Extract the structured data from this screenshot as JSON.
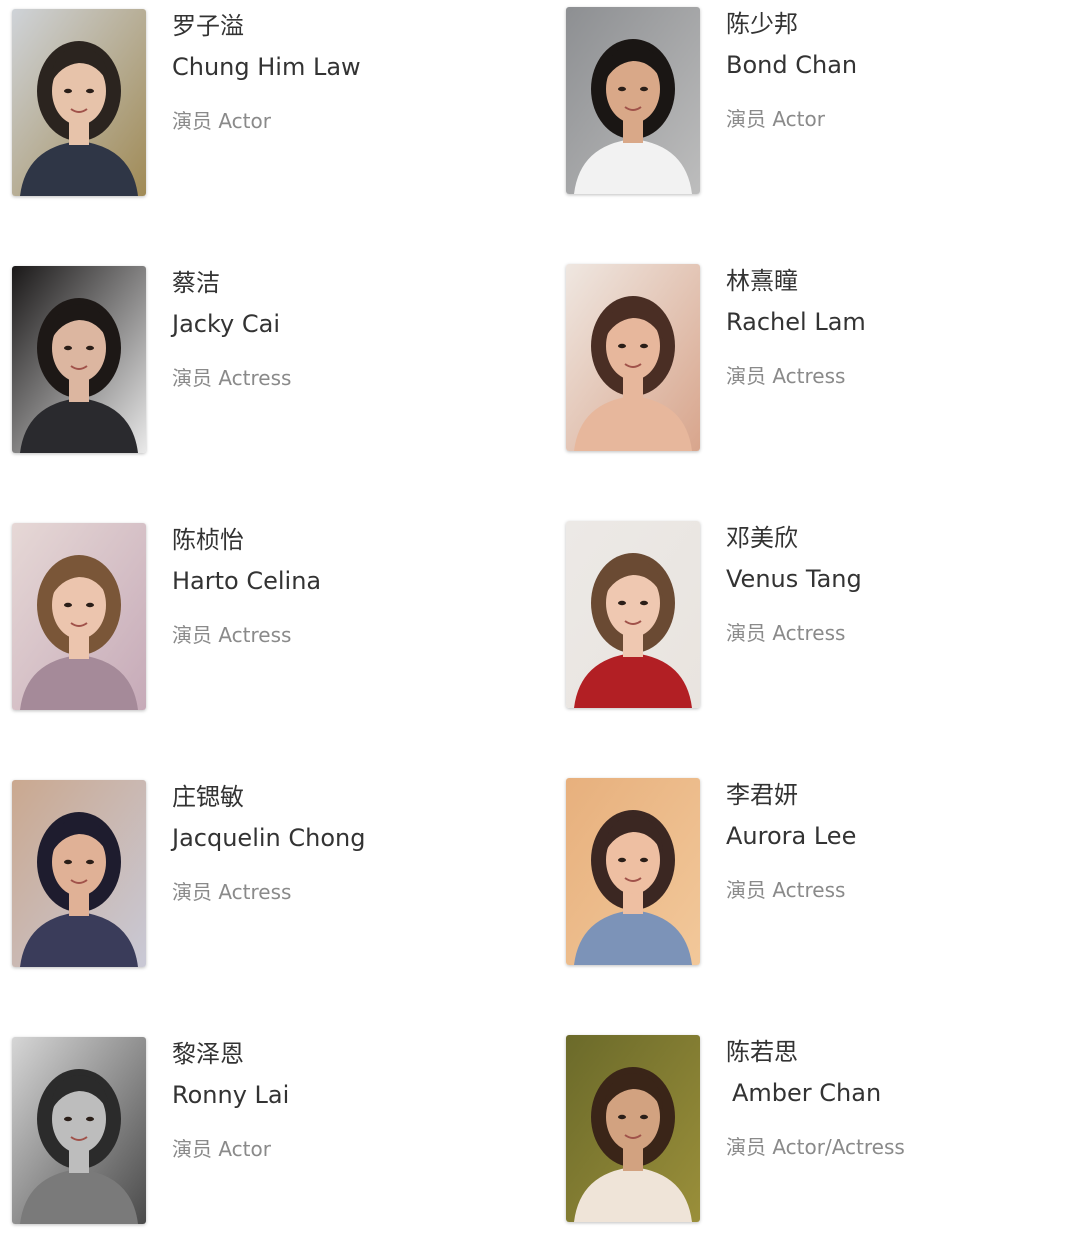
{
  "cast": [
    {
      "cn": "罗子溢",
      "en": "Chung Him Law",
      "role": "演员 Actor",
      "palette": {
        "bg": "#cfd3d8",
        "skin": "#e7c3aa",
        "hair": "#2b241f",
        "cloth": "#2f3646",
        "accent": "#a08a55"
      }
    },
    {
      "cn": "陈少邦",
      "en": "Bond Chan",
      "role": "演员 Actor",
      "palette": {
        "bg": "#8d8f92",
        "skin": "#d9a888",
        "hair": "#1a1614",
        "cloth": "#f2f2f2",
        "accent": "#bdbdbd"
      }
    },
    {
      "cn": "蔡洁",
      "en": "Jacky Cai",
      "role": "演员 Actress",
      "palette": {
        "bg": "#1a1818",
        "skin": "#dcb6a0",
        "hair": "#1d1816",
        "cloth": "#2a2a2e",
        "accent": "#e9e9e9"
      }
    },
    {
      "cn": "林熹瞳",
      "en": "Rachel Lam",
      "role": "演员 Actress",
      "palette": {
        "bg": "#efe7e1",
        "skin": "#e7b79c",
        "hair": "#4a2e24",
        "cloth": "#e7b79c",
        "accent": "#d8a58c"
      }
    },
    {
      "cn": "陈桢怡",
      "en": "Harto Celina",
      "role": "演员 Actress",
      "palette": {
        "bg": "#e6d8d6",
        "skin": "#ecc5ae",
        "hair": "#7a5638",
        "cloth": "#a58a99",
        "accent": "#c6aab8"
      }
    },
    {
      "cn": "邓美欣",
      "en": "Venus Tang",
      "role": "演员 Actress",
      "palette": {
        "bg": "#ece9e6",
        "skin": "#efc8b1",
        "hair": "#6a4a33",
        "cloth": "#b21f24",
        "accent": "#e9e4df"
      }
    },
    {
      "cn": "庄锶敏",
      "en": "Jacquelin Chong",
      "role": "演员 Actress",
      "palette": {
        "bg": "#caa88f",
        "skin": "#e0b196",
        "hair": "#1e1c2e",
        "cloth": "#3a3c5a",
        "accent": "#c9c9d6"
      }
    },
    {
      "cn": "李君妍",
      "en": "Aurora Lee",
      "role": "演员 Actress",
      "palette": {
        "bg": "#e7b07d",
        "skin": "#eebfa2",
        "hair": "#3b2722",
        "cloth": "#7c93b8",
        "accent": "#f2c89a"
      }
    },
    {
      "cn": "黎泽恩",
      "en": "Ronny Lai",
      "role": "演员 Actor",
      "palette": {
        "bg": "#d6d6d6",
        "skin": "#bdbdbd",
        "hair": "#2b2b2b",
        "cloth": "#7a7a7a",
        "accent": "#4a4a4a"
      }
    },
    {
      "cn": "陈若思",
      "en": "Amber Chan",
      "role": "演员 Actor/Actress",
      "palette": {
        "bg": "#6b6a2a",
        "skin": "#d2a280",
        "hair": "#3a2518",
        "cloth": "#efe4d8",
        "accent": "#9a8f3a"
      }
    }
  ]
}
